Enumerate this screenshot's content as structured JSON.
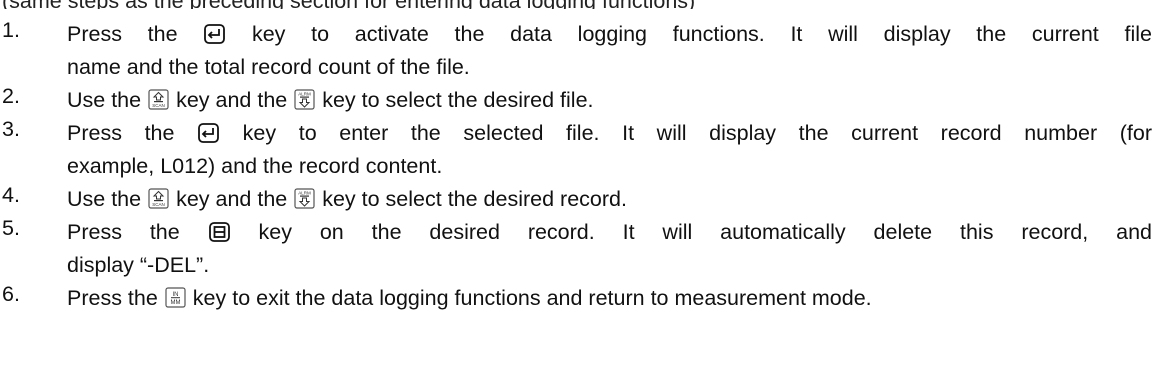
{
  "top_clipped_text": "(same steps as the preceding section for entering data logging functions)",
  "icons": {
    "enter": "enter-key-icon",
    "scan_up": "scan-up-key-icon",
    "alarm_down": "alarm-down-key-icon",
    "delete": "delete-key-icon",
    "in_mm": "in-mm-key-icon"
  },
  "steps": [
    {
      "number": "1.",
      "line1_a": "Press the",
      "line1_b": "key to activate the data logging functions. It will display the current file",
      "line2": "name and the total record count of the file."
    },
    {
      "number": "2.",
      "a": "Use the",
      "b": "key and the",
      "c": "key to select the desired file."
    },
    {
      "number": "3.",
      "line1_a": "Press the",
      "line1_b": "key to enter the selected file. It will display the current record number (for",
      "line2": "example, L012) and the record content."
    },
    {
      "number": "4.",
      "a": "Use the",
      "b": "key and the",
      "c": "key to select the desired record."
    },
    {
      "number": "5.",
      "line1_a": "Press the",
      "line1_b": "key on the desired record. It will automatically delete this record, and",
      "line2": "display “-DEL”."
    },
    {
      "number": "6.",
      "a": "Press the",
      "b": "key to exit the data logging functions and return to measurement mode."
    }
  ]
}
